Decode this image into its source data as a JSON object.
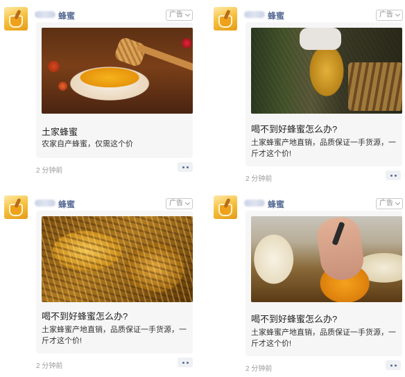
{
  "posts": [
    {
      "name": "蜂蜜",
      "ad_label": "广告",
      "title": "土家蜂蜜",
      "desc": "农家自产蜂蜜，仅需这个价",
      "time": "2 分钟前",
      "image": "honey-bowl-with-dipper"
    },
    {
      "name": "蜂蜜",
      "ad_label": "广告",
      "title": "喝不到好蜂蜜怎么办?",
      "desc": "土家蜂蜜产地直销，品质保证一手货源，一斤才这个价!",
      "time": "2 分钟前",
      "image": "beekeeper-honeycomb-frame"
    },
    {
      "name": "蜂蜜",
      "ad_label": "广告",
      "title": "喝不到好蜂蜜怎么办?",
      "desc": "土家蜂蜜产地直销，品质保证一手货源，一斤才这个价!",
      "time": "2 分钟前",
      "image": "honeycomb-closeup"
    },
    {
      "name": "蜂蜜",
      "ad_label": "广告",
      "title": "喝不到好蜂蜜怎么办?",
      "desc": "土家蜂蜜产地直销，品质保证一手货源，一斤才这个价!",
      "time": "2 分钟前",
      "image": "cutting-honeycomb"
    }
  ],
  "colors": {
    "name_link": "#576b95",
    "card_bg": "#f6f6f6",
    "time_text": "#9a9a9a"
  },
  "icons": {
    "avatar": "honey-jar-icon",
    "more": "more-dots-icon",
    "ad_dropdown": "chevron-down-icon"
  }
}
